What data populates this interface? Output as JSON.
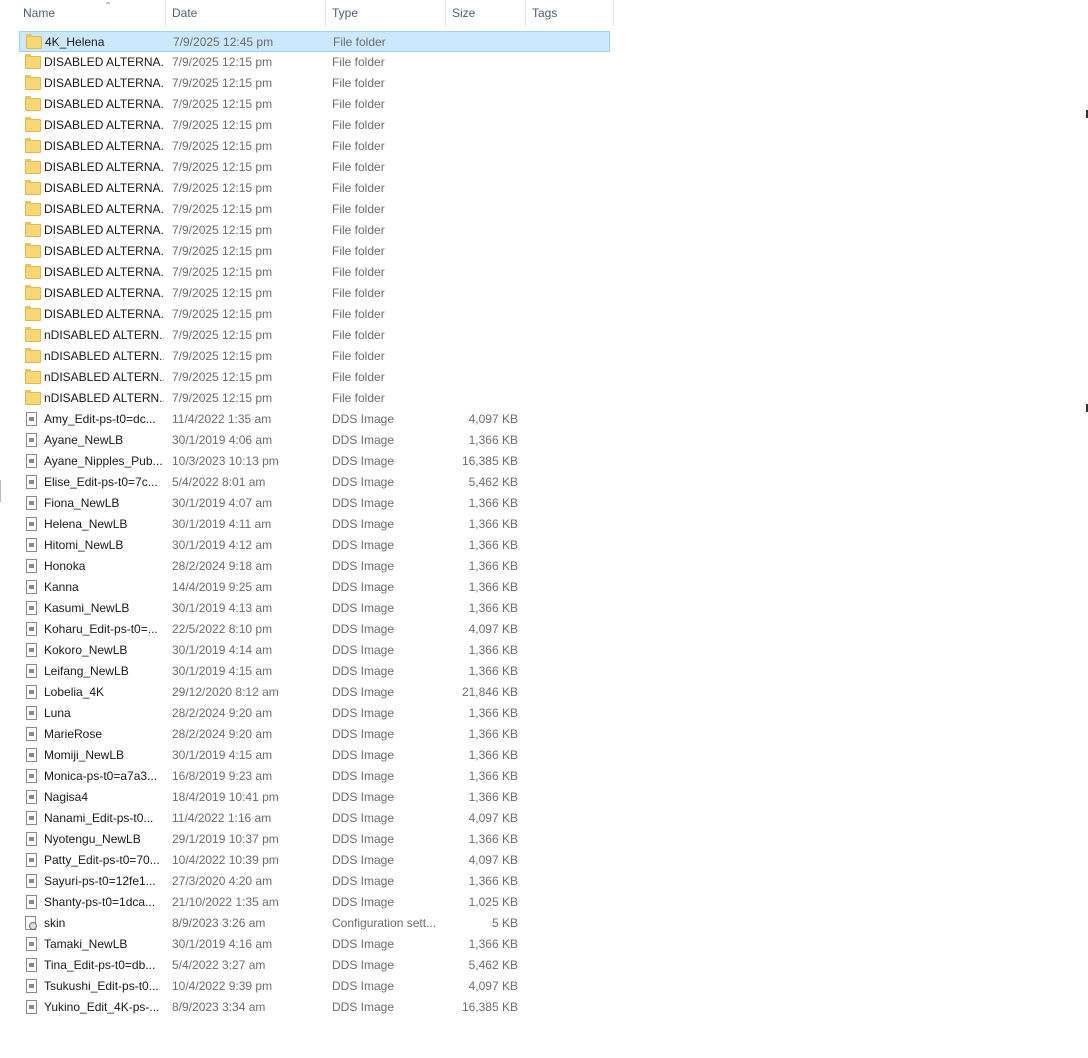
{
  "columns": {
    "name": "Name",
    "date": "Date",
    "type": "Type",
    "size": "Size",
    "tags": "Tags"
  },
  "sort": {
    "column": "name",
    "direction": "ascending",
    "indicator": "⌃"
  },
  "selected_row": 0,
  "colors": {
    "selection_bg": "#cce8ff",
    "selection_border": "#99d1ff",
    "folder": "#f7d774"
  },
  "rows": [
    {
      "name": "4K_Helena",
      "date": "7/9/2025 12:45 pm",
      "type": "File folder",
      "size": "",
      "icon": "folder-icon"
    },
    {
      "name": "DISABLED ALTERNA...",
      "date": "7/9/2025 12:15 pm",
      "type": "File folder",
      "size": "",
      "icon": "folder-icon"
    },
    {
      "name": "DISABLED ALTERNA...",
      "date": "7/9/2025 12:15 pm",
      "type": "File folder",
      "size": "",
      "icon": "folder-icon"
    },
    {
      "name": "DISABLED ALTERNA...",
      "date": "7/9/2025 12:15 pm",
      "type": "File folder",
      "size": "",
      "icon": "folder-icon"
    },
    {
      "name": "DISABLED ALTERNA...",
      "date": "7/9/2025 12:15 pm",
      "type": "File folder",
      "size": "",
      "icon": "folder-icon"
    },
    {
      "name": "DISABLED ALTERNA...",
      "date": "7/9/2025 12:15 pm",
      "type": "File folder",
      "size": "",
      "icon": "folder-icon"
    },
    {
      "name": "DISABLED ALTERNA...",
      "date": "7/9/2025 12:15 pm",
      "type": "File folder",
      "size": "",
      "icon": "folder-icon"
    },
    {
      "name": "DISABLED ALTERNA...",
      "date": "7/9/2025 12:15 pm",
      "type": "File folder",
      "size": "",
      "icon": "folder-icon"
    },
    {
      "name": "DISABLED ALTERNA...",
      "date": "7/9/2025 12:15 pm",
      "type": "File folder",
      "size": "",
      "icon": "folder-icon"
    },
    {
      "name": "DISABLED ALTERNA...",
      "date": "7/9/2025 12:15 pm",
      "type": "File folder",
      "size": "",
      "icon": "folder-icon"
    },
    {
      "name": "DISABLED ALTERNA...",
      "date": "7/9/2025 12:15 pm",
      "type": "File folder",
      "size": "",
      "icon": "folder-icon"
    },
    {
      "name": "DISABLED ALTERNA...",
      "date": "7/9/2025 12:15 pm",
      "type": "File folder",
      "size": "",
      "icon": "folder-icon"
    },
    {
      "name": "DISABLED ALTERNA...",
      "date": "7/9/2025 12:15 pm",
      "type": "File folder",
      "size": "",
      "icon": "folder-icon"
    },
    {
      "name": "DISABLED ALTERNA...",
      "date": "7/9/2025 12:15 pm",
      "type": "File folder",
      "size": "",
      "icon": "folder-icon"
    },
    {
      "name": "nDISABLED ALTERN...",
      "date": "7/9/2025 12:15 pm",
      "type": "File folder",
      "size": "",
      "icon": "folder-icon"
    },
    {
      "name": "nDISABLED ALTERN...",
      "date": "7/9/2025 12:15 pm",
      "type": "File folder",
      "size": "",
      "icon": "folder-icon"
    },
    {
      "name": "nDISABLED ALTERN...",
      "date": "7/9/2025 12:15 pm",
      "type": "File folder",
      "size": "",
      "icon": "folder-icon"
    },
    {
      "name": "nDISABLED ALTERN...",
      "date": "7/9/2025 12:15 pm",
      "type": "File folder",
      "size": "",
      "icon": "folder-icon"
    },
    {
      "name": "Amy_Edit-ps-t0=dc...",
      "date": "11/4/2022 1:35 am",
      "type": "DDS Image",
      "size": "4,097 KB",
      "icon": "file-icon"
    },
    {
      "name": "Ayane_NewLB",
      "date": "30/1/2019 4:06 am",
      "type": "DDS Image",
      "size": "1,366 KB",
      "icon": "file-icon"
    },
    {
      "name": "Ayane_Nipples_Pub...",
      "date": "10/3/2023 10:13 pm",
      "type": "DDS Image",
      "size": "16,385 KB",
      "icon": "file-icon"
    },
    {
      "name": "Elise_Edit-ps-t0=7c...",
      "date": "5/4/2022 8:01 am",
      "type": "DDS Image",
      "size": "5,462 KB",
      "icon": "file-icon"
    },
    {
      "name": "Fiona_NewLB",
      "date": "30/1/2019 4:07 am",
      "type": "DDS Image",
      "size": "1,366 KB",
      "icon": "file-icon"
    },
    {
      "name": "Helena_NewLB",
      "date": "30/1/2019 4:11 am",
      "type": "DDS Image",
      "size": "1,366 KB",
      "icon": "file-icon"
    },
    {
      "name": "Hitomi_NewLB",
      "date": "30/1/2019 4:12 am",
      "type": "DDS Image",
      "size": "1,366 KB",
      "icon": "file-icon"
    },
    {
      "name": "Honoka",
      "date": "28/2/2024 9:18 am",
      "type": "DDS Image",
      "size": "1,366 KB",
      "icon": "file-icon"
    },
    {
      "name": "Kanna",
      "date": "14/4/2019 9:25 am",
      "type": "DDS Image",
      "size": "1,366 KB",
      "icon": "file-icon"
    },
    {
      "name": "Kasumi_NewLB",
      "date": "30/1/2019 4:13 am",
      "type": "DDS Image",
      "size": "1,366 KB",
      "icon": "file-icon"
    },
    {
      "name": "Koharu_Edit-ps-t0=...",
      "date": "22/5/2022 8:10 pm",
      "type": "DDS Image",
      "size": "4,097 KB",
      "icon": "file-icon"
    },
    {
      "name": "Kokoro_NewLB",
      "date": "30/1/2019 4:14 am",
      "type": "DDS Image",
      "size": "1,366 KB",
      "icon": "file-icon"
    },
    {
      "name": "Leifang_NewLB",
      "date": "30/1/2019 4:15 am",
      "type": "DDS Image",
      "size": "1,366 KB",
      "icon": "file-icon"
    },
    {
      "name": "Lobelia_4K",
      "date": "29/12/2020 8:12 am",
      "type": "DDS Image",
      "size": "21,846 KB",
      "icon": "file-icon"
    },
    {
      "name": "Luna",
      "date": "28/2/2024 9:20 am",
      "type": "DDS Image",
      "size": "1,366 KB",
      "icon": "file-icon"
    },
    {
      "name": "MarieRose",
      "date": "28/2/2024 9:20 am",
      "type": "DDS Image",
      "size": "1,366 KB",
      "icon": "file-icon"
    },
    {
      "name": "Momiji_NewLB",
      "date": "30/1/2019 4:15 am",
      "type": "DDS Image",
      "size": "1,366 KB",
      "icon": "file-icon"
    },
    {
      "name": "Monica-ps-t0=a7a3...",
      "date": "16/8/2019 9:23 am",
      "type": "DDS Image",
      "size": "1,366 KB",
      "icon": "file-icon"
    },
    {
      "name": "Nagisa4",
      "date": "18/4/2019 10:41 pm",
      "type": "DDS Image",
      "size": "1,366 KB",
      "icon": "file-icon"
    },
    {
      "name": "Nanami_Edit-ps-t0...",
      "date": "11/4/2022 1:16 am",
      "type": "DDS Image",
      "size": "4,097 KB",
      "icon": "file-icon"
    },
    {
      "name": "Nyotengu_NewLB",
      "date": "29/1/2019 10:37 pm",
      "type": "DDS Image",
      "size": "1,366 KB",
      "icon": "file-icon"
    },
    {
      "name": "Patty_Edit-ps-t0=70...",
      "date": "10/4/2022 10:39 pm",
      "type": "DDS Image",
      "size": "4,097 KB",
      "icon": "file-icon"
    },
    {
      "name": "Sayuri-ps-t0=12fe1...",
      "date": "27/3/2020 4:20 am",
      "type": "DDS Image",
      "size": "1,366 KB",
      "icon": "file-icon"
    },
    {
      "name": "Shanty-ps-t0=1dca...",
      "date": "21/10/2022 1:35 am",
      "type": "DDS Image",
      "size": "1,025 KB",
      "icon": "file-icon"
    },
    {
      "name": "skin",
      "date": "8/9/2023 3:26 am",
      "type": "Configuration sett...",
      "size": "5 KB",
      "icon": "config-icon"
    },
    {
      "name": "Tamaki_NewLB",
      "date": "30/1/2019 4:16 am",
      "type": "DDS Image",
      "size": "1,366 KB",
      "icon": "file-icon"
    },
    {
      "name": "Tina_Edit-ps-t0=db...",
      "date": "5/4/2022 3:27 am",
      "type": "DDS Image",
      "size": "5,462 KB",
      "icon": "file-icon"
    },
    {
      "name": "Tsukushi_Edit-ps-t0...",
      "date": "10/4/2022 9:39 pm",
      "type": "DDS Image",
      "size": "4,097 KB",
      "icon": "file-icon"
    },
    {
      "name": "Yukino_Edit_4K-ps-...",
      "date": "8/9/2023 3:34 am",
      "type": "DDS Image",
      "size": "16,385 KB",
      "icon": "file-icon"
    }
  ]
}
